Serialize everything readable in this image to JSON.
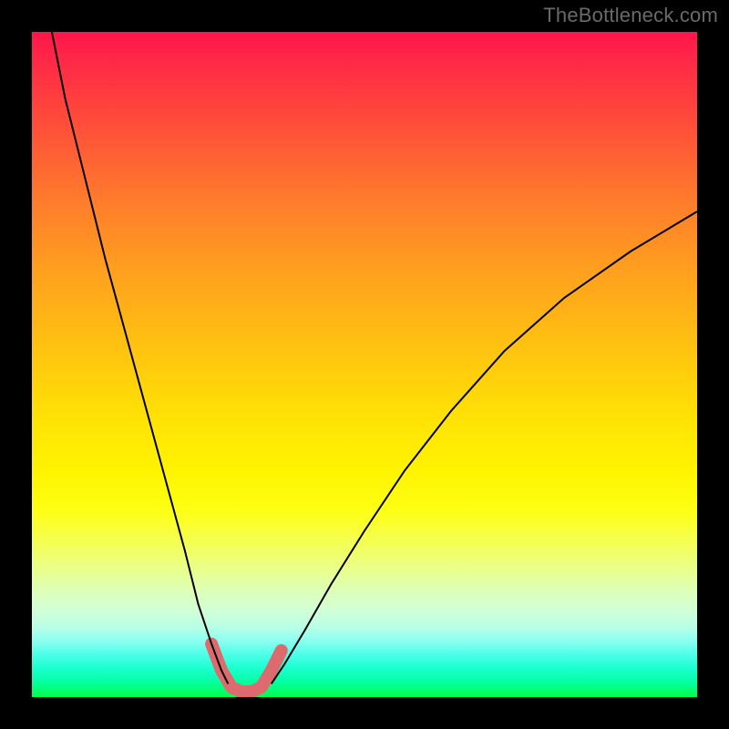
{
  "watermark": "TheBottleneck.com",
  "chart_data": {
    "type": "line",
    "title": "",
    "xlabel": "",
    "ylabel": "",
    "xlim": [
      0,
      100
    ],
    "ylim": [
      0,
      100
    ],
    "grid": false,
    "gradient_bands": [
      {
        "pos": 0,
        "color": "#ff154a"
      },
      {
        "pos": 15,
        "color": "#ff5238"
      },
      {
        "pos": 36,
        "color": "#ffa01e"
      },
      {
        "pos": 58,
        "color": "#ffe205"
      },
      {
        "pos": 77,
        "color": "#f4ff57"
      },
      {
        "pos": 91,
        "color": "#8efff0"
      },
      {
        "pos": 100,
        "color": "#00ff49"
      }
    ],
    "series": [
      {
        "name": "left-branch",
        "stroke": "#000000",
        "stroke_width": 2,
        "x": [
          3,
          5,
          8,
          11,
          14,
          17,
          20,
          23,
          25,
          27,
          28.5,
          29.5
        ],
        "y": [
          100,
          90,
          78,
          66,
          55,
          44,
          33,
          22,
          14,
          8,
          4,
          2
        ]
      },
      {
        "name": "right-branch",
        "stroke": "#000000",
        "stroke_width": 2,
        "x": [
          36,
          38,
          41,
          45,
          50,
          56,
          63,
          71,
          80,
          90,
          100
        ],
        "y": [
          2,
          5,
          10,
          17,
          25,
          34,
          43,
          52,
          60,
          67,
          73
        ]
      },
      {
        "name": "trough-highlight",
        "stroke": "#dd6a6f",
        "stroke_width": 14,
        "linecap": "round",
        "x": [
          27,
          28.5,
          30,
          31.5,
          33,
          34.5,
          36,
          37.5
        ],
        "y": [
          8,
          4,
          1.5,
          0.8,
          0.8,
          1.5,
          4,
          7
        ]
      }
    ]
  }
}
